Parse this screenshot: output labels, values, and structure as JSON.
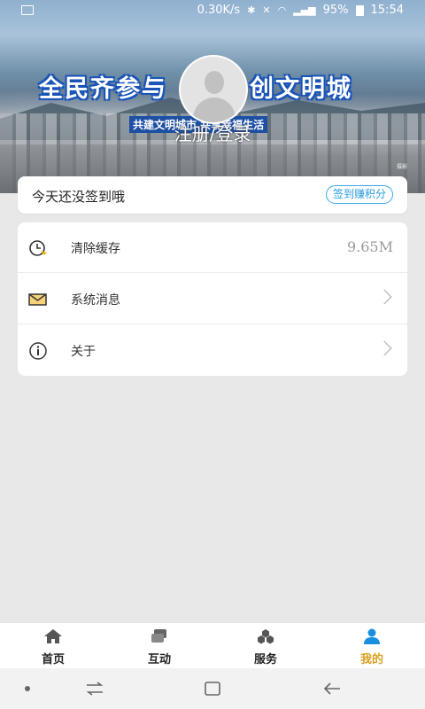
{
  "status_bar": {
    "speed": "0.30K/s",
    "battery": "95%",
    "time": "15:54"
  },
  "hero": {
    "slogan_left": "全民齐参与",
    "slogan_right": "创文明城",
    "subtitle": "共建文明城市 共享幸福生活",
    "credit": "摄影",
    "login_text": "注册/登录"
  },
  "sign_card": {
    "text": "今天还没签到哦",
    "button": "签到赚积分"
  },
  "menu": {
    "items": [
      {
        "label": "清除缓存",
        "value": "9.65M",
        "icon": "clock-icon"
      },
      {
        "label": "系统消息",
        "icon": "mail-icon"
      },
      {
        "label": "关于",
        "icon": "info-icon"
      }
    ]
  },
  "tabbar": {
    "tabs": [
      {
        "label": "首页",
        "icon": "home-icon"
      },
      {
        "label": "互动",
        "icon": "interact-icon"
      },
      {
        "label": "服务",
        "icon": "service-icon"
      },
      {
        "label": "我的",
        "icon": "profile-icon",
        "active": true
      }
    ],
    "active_color": "#d9a020"
  },
  "colors": {
    "accent": "#2a9be0",
    "background": "#e8e8e8"
  }
}
